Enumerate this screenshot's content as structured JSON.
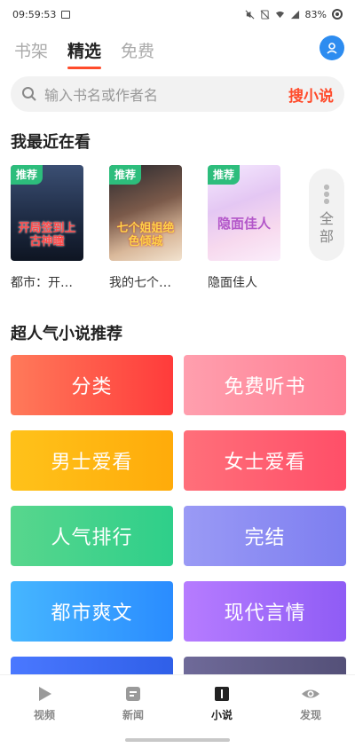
{
  "status_bar": {
    "time": "09:59:53",
    "battery": "83%"
  },
  "top_tabs": [
    {
      "label": "书架",
      "active": false
    },
    {
      "label": "精选",
      "active": true
    },
    {
      "label": "免费",
      "active": false
    }
  ],
  "search": {
    "placeholder": "输入书名或作者名",
    "button": "搜小说"
  },
  "recent": {
    "title": "我最近在看",
    "books": [
      {
        "badge": "推荐",
        "cover_title": "开局签到上古神瞳",
        "name": "都市：开…"
      },
      {
        "badge": "推荐",
        "cover_title": "七个姐姐绝色倾城",
        "name": "我的七个…"
      },
      {
        "badge": "推荐",
        "cover_title": "隐面佳人",
        "name": "隐面佳人"
      }
    ],
    "more_label": "全部"
  },
  "popular": {
    "title": "超人气小说推荐",
    "categories": [
      {
        "label": "分类",
        "color_from": "#ff7a5a",
        "color_to": "#ff3b3b"
      },
      {
        "label": "免费听书",
        "color_from": "#ff9fae",
        "color_to": "#ff7f93"
      },
      {
        "label": "男士爱看",
        "color_from": "#ffc21a",
        "color_to": "#ffab0a"
      },
      {
        "label": "女士爱看",
        "color_from": "#ff6f7a",
        "color_to": "#ff4f68"
      },
      {
        "label": "人气排行",
        "color_from": "#58d68d",
        "color_to": "#2ecf8a"
      },
      {
        "label": "完结",
        "color_from": "#9a9af5",
        "color_to": "#7d7ef0"
      },
      {
        "label": "都市爽文",
        "color_from": "#46b6ff",
        "color_to": "#2a8cff"
      },
      {
        "label": "现代言情",
        "color_from": "#b67cff",
        "color_to": "#8f5cf5"
      },
      {
        "label": "",
        "color_from": "#4a78ff",
        "color_to": "#2f5fe8"
      },
      {
        "label": "",
        "color_from": "#6f6a99",
        "color_to": "#545078"
      }
    ]
  },
  "bottom_nav": [
    {
      "label": "视频",
      "icon": "play-icon",
      "active": false
    },
    {
      "label": "新闻",
      "icon": "news-icon",
      "active": false
    },
    {
      "label": "小说",
      "icon": "book-icon",
      "active": true
    },
    {
      "label": "发现",
      "icon": "eye-icon",
      "active": false
    }
  ]
}
